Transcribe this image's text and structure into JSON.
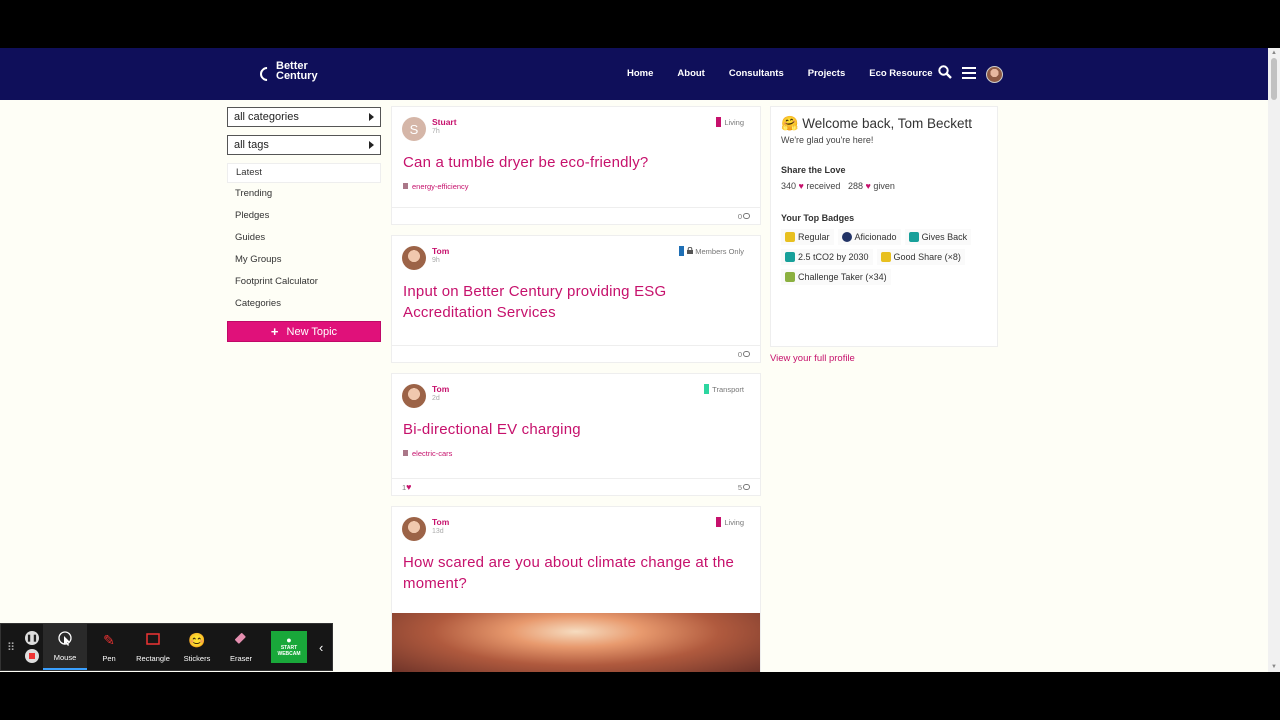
{
  "header": {
    "logo_line1": "Better",
    "logo_line2": "Century",
    "nav": [
      "Home",
      "About",
      "Consultants",
      "Projects",
      "Eco Resource"
    ],
    "icons": [
      "search-icon",
      "hamburger-menu-icon",
      "user-avatar"
    ]
  },
  "left": {
    "categories_label": "all categories",
    "tags_label": "all tags",
    "nav": [
      "Latest",
      "Trending",
      "Pledges",
      "Guides",
      "My Groups",
      "Footprint Calculator",
      "Categories"
    ],
    "new_topic_label": "New Topic"
  },
  "feed": [
    {
      "author": "Stuart",
      "ago": "7h",
      "avatar_letter": "S",
      "category": "Living",
      "category_color": "#c6116c",
      "title": "Can a tumble dryer be eco-friendly?",
      "tag": "energy-efficiency",
      "likes": "",
      "replies": "0"
    },
    {
      "author": "Tom",
      "ago": "9h",
      "category": "Members Only",
      "category_color": "#1f6fb5",
      "title": "Input on Better Century providing ESG Accreditation Services",
      "tag": "",
      "likes": "",
      "replies": "0"
    },
    {
      "author": "Tom",
      "ago": "2d",
      "category": "Transport",
      "category_color": "#2dd6a0",
      "title": "Bi-directional EV charging",
      "tag": "electric-cars",
      "likes": "1",
      "replies": "5"
    },
    {
      "author": "Tom",
      "ago": "13d",
      "category": "Living",
      "category_color": "#c6116c",
      "title": "How scared are you about climate change at the moment?",
      "tag": "",
      "likes": "",
      "replies": ""
    }
  ],
  "right": {
    "welcome": "Welcome back, Tom Beckett",
    "welcome_emoji": "🤗",
    "glad": "We're glad you're here!",
    "share_title": "Share the Love",
    "received_count": "340",
    "received_label": "received",
    "given_count": "288",
    "given_label": "given",
    "badges_title": "Your Top Badges",
    "badges": [
      {
        "label": "Regular",
        "color": "#e8c020"
      },
      {
        "label": "Aficionado",
        "color": "#223366"
      },
      {
        "label": "Gives Back",
        "color": "#18a09a"
      },
      {
        "label": "2.5 tCO2 by 2030",
        "color": "#18a09a"
      },
      {
        "label": "Good Share (×8)",
        "color": "#e8c020"
      },
      {
        "label": "Challenge Taker (×34)",
        "color": "#8bb040"
      }
    ],
    "profile_link": "View your full profile"
  },
  "recorder": {
    "tools": [
      {
        "label": "Mouse",
        "icon": "cursor-icon"
      },
      {
        "label": "Pen",
        "icon": "pen-icon"
      },
      {
        "label": "Rectangle",
        "icon": "rectangle-icon"
      },
      {
        "label": "Stickers",
        "icon": "sticker-icon"
      },
      {
        "label": "Eraser",
        "icon": "eraser-icon"
      }
    ],
    "webcam_label": "START WEBCAM"
  }
}
